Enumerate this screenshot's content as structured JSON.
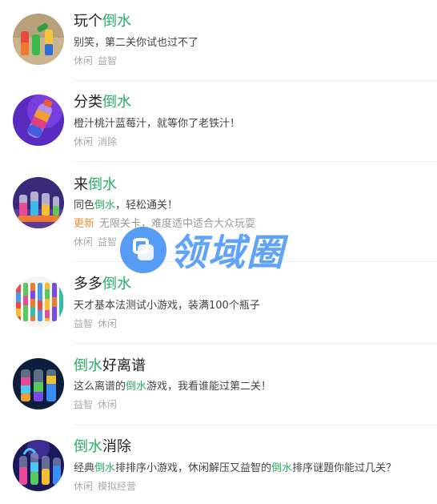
{
  "items": [
    {
      "title_pre": "玩个",
      "title_hl": "倒水",
      "title_post": "",
      "desc": "别笑，第二关你试也过不了",
      "tags": [
        "休闲",
        "益智"
      ]
    },
    {
      "title_pre": "分类",
      "title_hl": "倒水",
      "title_post": "",
      "desc": "橙汁桃汁蓝莓汁，就等你了老铁汁！",
      "tags": [
        "休闲",
        "消除"
      ]
    },
    {
      "title_pre": "来",
      "title_hl": "倒水",
      "title_post": "",
      "desc_pre": "同色",
      "desc_hl": "倒水",
      "desc_post": "，轻松通关！",
      "update_badge": "更新",
      "update_text": "无限关卡，难度适中适合大众玩耍",
      "tags": [
        "休闲",
        "益智"
      ]
    },
    {
      "title_pre": "多多",
      "title_hl": "倒水",
      "title_post": "",
      "desc": "天才基本法测试小游戏，装满100个瓶子",
      "tags": [
        "益智",
        "休闲"
      ]
    },
    {
      "title_pre": "",
      "title_hl": "倒水",
      "title_post": "好离谱",
      "desc_pre": "这么离谱的",
      "desc_hl": "倒水",
      "desc_post": "游戏，我看谁能过第二关！",
      "tags": [
        "益智",
        "休闲"
      ]
    },
    {
      "title_pre": "",
      "title_hl": "倒水",
      "title_post": "消除",
      "desc_pre": "经典",
      "desc_hl": "倒水",
      "desc_mid": "排排序小游戏，休闲解压又益智的",
      "desc_hl2": "倒水",
      "desc_post": "排序谜题你能过几关？",
      "tags": [
        "休闲",
        "模拟经营"
      ]
    }
  ],
  "watermark": {
    "text": "领域圈"
  },
  "colors": {
    "highlight": "#2aae67",
    "update_badge": "#f0923a",
    "watermark": "#3a8df5"
  }
}
